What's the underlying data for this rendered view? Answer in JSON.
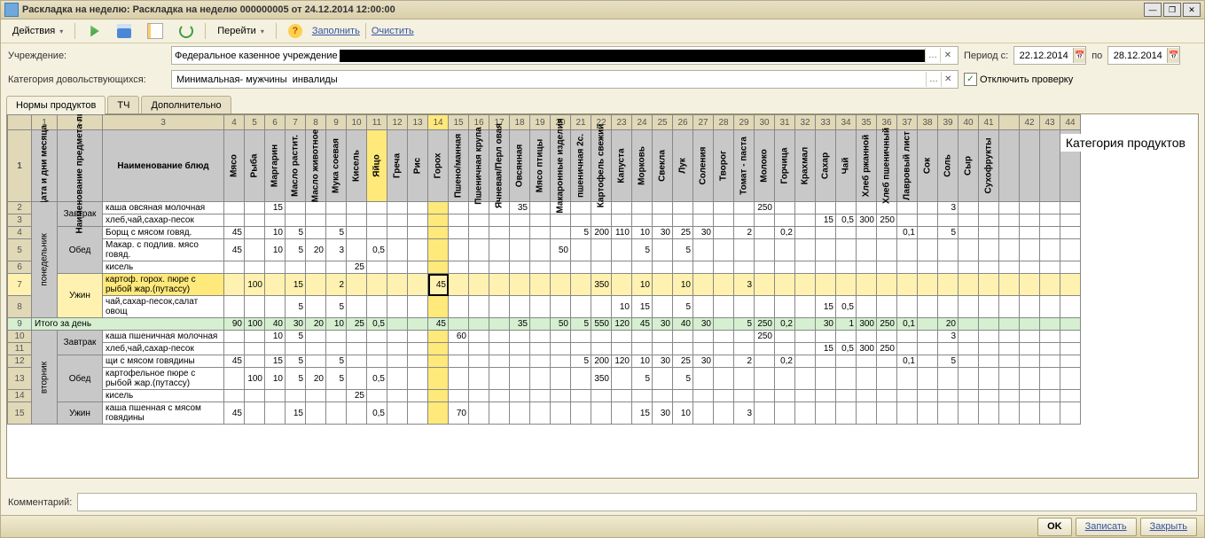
{
  "title": "Раскладка на неделю: Раскладка на неделю 000000005 от 24.12.2014 12:00:00",
  "toolbar": {
    "actions": "Действия",
    "goto": "Перейти",
    "fill": "Заполнить",
    "clear": "Очистить"
  },
  "form": {
    "institution_label": "Учреждение:",
    "institution_value": "Федеральное казенное учреждение",
    "category_label": "Категория довольствующихся:",
    "category_value": "Минимальная- мужчины  инвалиды",
    "period_label": "Период с:",
    "period_from": "22.12.2014",
    "period_to_label": "по",
    "period_to": "28.12.2014",
    "disable_check": "Отключить проверку",
    "comment_label": "Комментарий:",
    "comment_value": ""
  },
  "tabs": [
    "Нормы продуктов",
    "ТЧ",
    "Дополнительно"
  ],
  "status": {
    "ok": "OK",
    "save": "Записать",
    "close": "Закрыть"
  },
  "category_products_label": "Категория продуктов",
  "col_nums": [
    "1",
    "2",
    "3",
    "4",
    "5",
    "6",
    "7",
    "8",
    "9",
    "10",
    "11",
    "12",
    "13",
    "14",
    "15",
    "16",
    "17",
    "18",
    "19",
    "20",
    "21",
    "22",
    "23",
    "24",
    "25",
    "26",
    "27",
    "28",
    "29",
    "30",
    "31",
    "32",
    "33",
    "34",
    "35",
    "36",
    "37",
    "38",
    "39",
    "40",
    "41",
    "",
    "42",
    "43",
    "44"
  ],
  "col_headers": [
    "Дата и дни месяца",
    "Наименование предмета пищи",
    "Наименование блюд",
    "Мясо",
    "Рыба",
    "Маргарин",
    "Масло растит.",
    "Масло животное",
    "Мука соевая",
    "Кисель",
    "Яйцо",
    "Греча",
    "Рис",
    "Горох",
    "Пшено/манная",
    "Пшеничная крупа",
    "Ячневая/Перл овая",
    "Овсянная",
    "Мясо птицы",
    "Макаронные изделия",
    "пшеничная 2с.",
    "Картофель свежий",
    "Капуста",
    "Морковь",
    "Свекла",
    "Лук",
    "Соления",
    "Творог",
    "Томат - паста",
    "Молоко",
    "Горчица",
    "Крахмал",
    "Сахар",
    "Чай",
    "Хлеб ржанной",
    "Хлеб пшеничный",
    "Лавровый лист",
    "Сок",
    "Соль",
    "Сыр",
    "Сухофрукты"
  ],
  "rows": [
    {
      "idx": "2",
      "day": "понедельник",
      "meal": "Завтрак",
      "dish": "каша овсяная молочная",
      "vals": {
        "6": "15",
        "18": "35",
        "30": "250",
        "39": "3"
      }
    },
    {
      "idx": "3",
      "dish": "хлеб,чай,сахар-песок",
      "vals": {
        "33": "15",
        "34": "0,5",
        "35": "300",
        "36": "250"
      }
    },
    {
      "idx": "4",
      "meal": "Обед",
      "dish": "Борщ с мясом говяд.",
      "vals": {
        "4": "45",
        "6": "10",
        "7": "5",
        "9": "5",
        "21": "5",
        "22": "200",
        "23": "110",
        "24": "10",
        "25": "30",
        "26": "25",
        "27": "30",
        "29": "2",
        "31": "0,2",
        "37": "0,1",
        "39": "5"
      }
    },
    {
      "idx": "5",
      "dish": "Макар. с подлив. мясо говяд.",
      "vals": {
        "4": "45",
        "6": "10",
        "7": "5",
        "8": "20",
        "9": "3",
        "11": "0,5",
        "20": "50",
        "24": "5",
        "26": "5"
      }
    },
    {
      "idx": "6",
      "dish": "кисель",
      "vals": {
        "10": "25"
      }
    },
    {
      "idx": "7",
      "meal": "Ужин",
      "dish": "картоф. горох. пюре с рыбой жар.(путассу)",
      "hl": true,
      "vals": {
        "5": "100",
        "7": "15",
        "9": "2",
        "14": "45",
        "22": "350",
        "24": "10",
        "26": "10",
        "29": "3"
      }
    },
    {
      "idx": "8",
      "dish": "чай,сахар-песок,салат овощ",
      "vals": {
        "7": "5",
        "9": "5",
        "23": "10",
        "24": "15",
        "26": "5",
        "33": "15",
        "34": "0,5"
      }
    },
    {
      "idx": "9",
      "total": true,
      "dish": "Итого за день",
      "vals": {
        "4": "90",
        "5": "100",
        "6": "40",
        "7": "30",
        "8": "20",
        "9": "10",
        "10": "25",
        "11": "0,5",
        "14": "45",
        "18": "35",
        "20": "50",
        "21": "5",
        "22": "550",
        "23": "120",
        "24": "45",
        "25": "30",
        "26": "40",
        "27": "30",
        "29": "5",
        "30": "250",
        "31": "0,2",
        "33": "30",
        "34": "1",
        "35": "300",
        "36": "250",
        "37": "0,1",
        "39": "20"
      }
    },
    {
      "idx": "10",
      "day": "вторник",
      "meal": "Завтрак",
      "dish": "каша пшеничная молочная",
      "vals": {
        "6": "10",
        "7": "5",
        "15": "60",
        "30": "250",
        "39": "3"
      }
    },
    {
      "idx": "11",
      "dish": "хлеб,чай,сахар-песок",
      "vals": {
        "33": "15",
        "34": "0,5",
        "35": "300",
        "36": "250"
      }
    },
    {
      "idx": "12",
      "meal": "Обед",
      "dish": "щи с мясом говядины",
      "vals": {
        "4": "45",
        "6": "15",
        "7": "5",
        "9": "5",
        "21": "5",
        "22": "200",
        "23": "120",
        "24": "10",
        "25": "30",
        "26": "25",
        "27": "30",
        "29": "2",
        "31": "0,2",
        "37": "0,1",
        "39": "5"
      }
    },
    {
      "idx": "13",
      "dish": "картофельное пюре с рыбой жар.(путассу)",
      "vals": {
        "5": "100",
        "6": "10",
        "7": "5",
        "8": "20",
        "9": "5",
        "11": "0,5",
        "22": "350",
        "24": "5",
        "26": "5"
      }
    },
    {
      "idx": "14",
      "dish": "кисель",
      "vals": {
        "10": "25"
      }
    },
    {
      "idx": "15",
      "meal": "Ужин",
      "dish": "каша пшенная с мясом говядины",
      "vals": {
        "4": "45",
        "7": "15",
        "11": "0,5",
        "15": "70",
        "24": "15",
        "25": "30",
        "26": "10",
        "29": "3"
      }
    }
  ]
}
